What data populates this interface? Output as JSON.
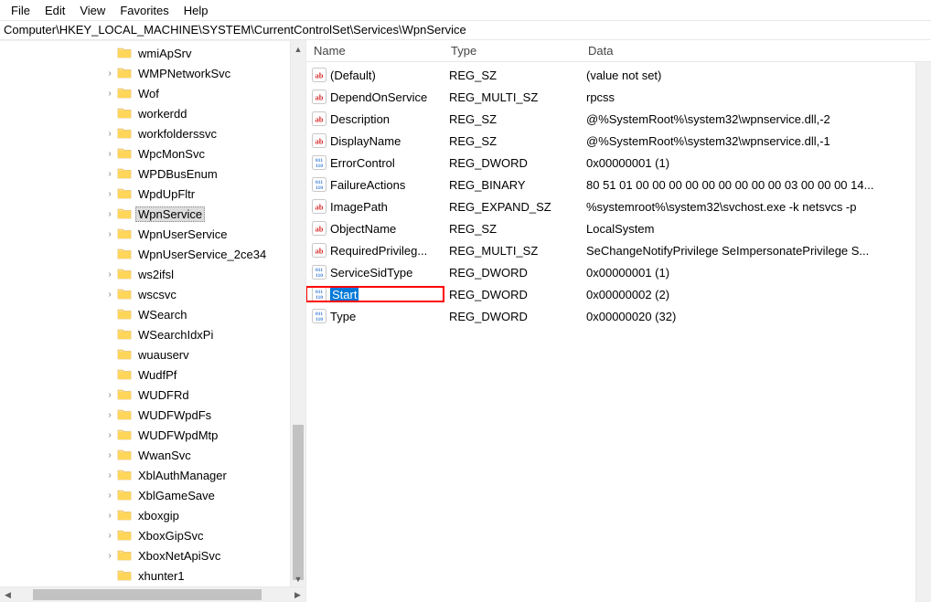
{
  "menu": [
    "File",
    "Edit",
    "View",
    "Favorites",
    "Help"
  ],
  "address": "Computer\\HKEY_LOCAL_MACHINE\\SYSTEM\\CurrentControlSet\\Services\\WpnService",
  "tree": [
    {
      "label": "wmiApSrv",
      "expandable": false
    },
    {
      "label": "WMPNetworkSvc",
      "expandable": true
    },
    {
      "label": "Wof",
      "expandable": true
    },
    {
      "label": "workerdd",
      "expandable": false
    },
    {
      "label": "workfolderssvc",
      "expandable": true
    },
    {
      "label": "WpcMonSvc",
      "expandable": true
    },
    {
      "label": "WPDBusEnum",
      "expandable": true
    },
    {
      "label": "WpdUpFltr",
      "expandable": true
    },
    {
      "label": "WpnService",
      "expandable": true,
      "selected": true
    },
    {
      "label": "WpnUserService",
      "expandable": true
    },
    {
      "label": "WpnUserService_2ce34",
      "expandable": false
    },
    {
      "label": "ws2ifsl",
      "expandable": true
    },
    {
      "label": "wscsvc",
      "expandable": true
    },
    {
      "label": "WSearch",
      "expandable": false
    },
    {
      "label": "WSearchIdxPi",
      "expandable": false
    },
    {
      "label": "wuauserv",
      "expandable": false
    },
    {
      "label": "WudfPf",
      "expandable": false
    },
    {
      "label": "WUDFRd",
      "expandable": true
    },
    {
      "label": "WUDFWpdFs",
      "expandable": true
    },
    {
      "label": "WUDFWpdMtp",
      "expandable": true
    },
    {
      "label": "WwanSvc",
      "expandable": true
    },
    {
      "label": "XblAuthManager",
      "expandable": true
    },
    {
      "label": "XblGameSave",
      "expandable": true
    },
    {
      "label": "xboxgip",
      "expandable": true
    },
    {
      "label": "XboxGipSvc",
      "expandable": true
    },
    {
      "label": "XboxNetApiSvc",
      "expandable": true
    },
    {
      "label": "xhunter1",
      "expandable": false
    }
  ],
  "columns": {
    "name": "Name",
    "type": "Type",
    "data": "Data"
  },
  "values": [
    {
      "icon": "string",
      "name": "(Default)",
      "type": "REG_SZ",
      "data": "(value not set)"
    },
    {
      "icon": "string",
      "name": "DependOnService",
      "type": "REG_MULTI_SZ",
      "data": "rpcss"
    },
    {
      "icon": "string",
      "name": "Description",
      "type": "REG_SZ",
      "data": "@%SystemRoot%\\system32\\wpnservice.dll,-2"
    },
    {
      "icon": "string",
      "name": "DisplayName",
      "type": "REG_SZ",
      "data": "@%SystemRoot%\\system32\\wpnservice.dll,-1"
    },
    {
      "icon": "binary",
      "name": "ErrorControl",
      "type": "REG_DWORD",
      "data": "0x00000001 (1)"
    },
    {
      "icon": "binary",
      "name": "FailureActions",
      "type": "REG_BINARY",
      "data": "80 51 01 00 00 00 00 00 00 00 00 00 03 00 00 00 14..."
    },
    {
      "icon": "string",
      "name": "ImagePath",
      "type": "REG_EXPAND_SZ",
      "data": "%systemroot%\\system32\\svchost.exe -k netsvcs -p"
    },
    {
      "icon": "string",
      "name": "ObjectName",
      "type": "REG_SZ",
      "data": "LocalSystem"
    },
    {
      "icon": "string",
      "name": "RequiredPrivileg...",
      "type": "REG_MULTI_SZ",
      "data": "SeChangeNotifyPrivilege SeImpersonatePrivilege S..."
    },
    {
      "icon": "binary",
      "name": "ServiceSidType",
      "type": "REG_DWORD",
      "data": "0x00000001 (1)"
    },
    {
      "icon": "binary",
      "name": "Start",
      "type": "REG_DWORD",
      "data": "0x00000002 (2)",
      "highlight": true
    },
    {
      "icon": "binary",
      "name": "Type",
      "type": "REG_DWORD",
      "data": "0x00000020 (32)"
    }
  ]
}
